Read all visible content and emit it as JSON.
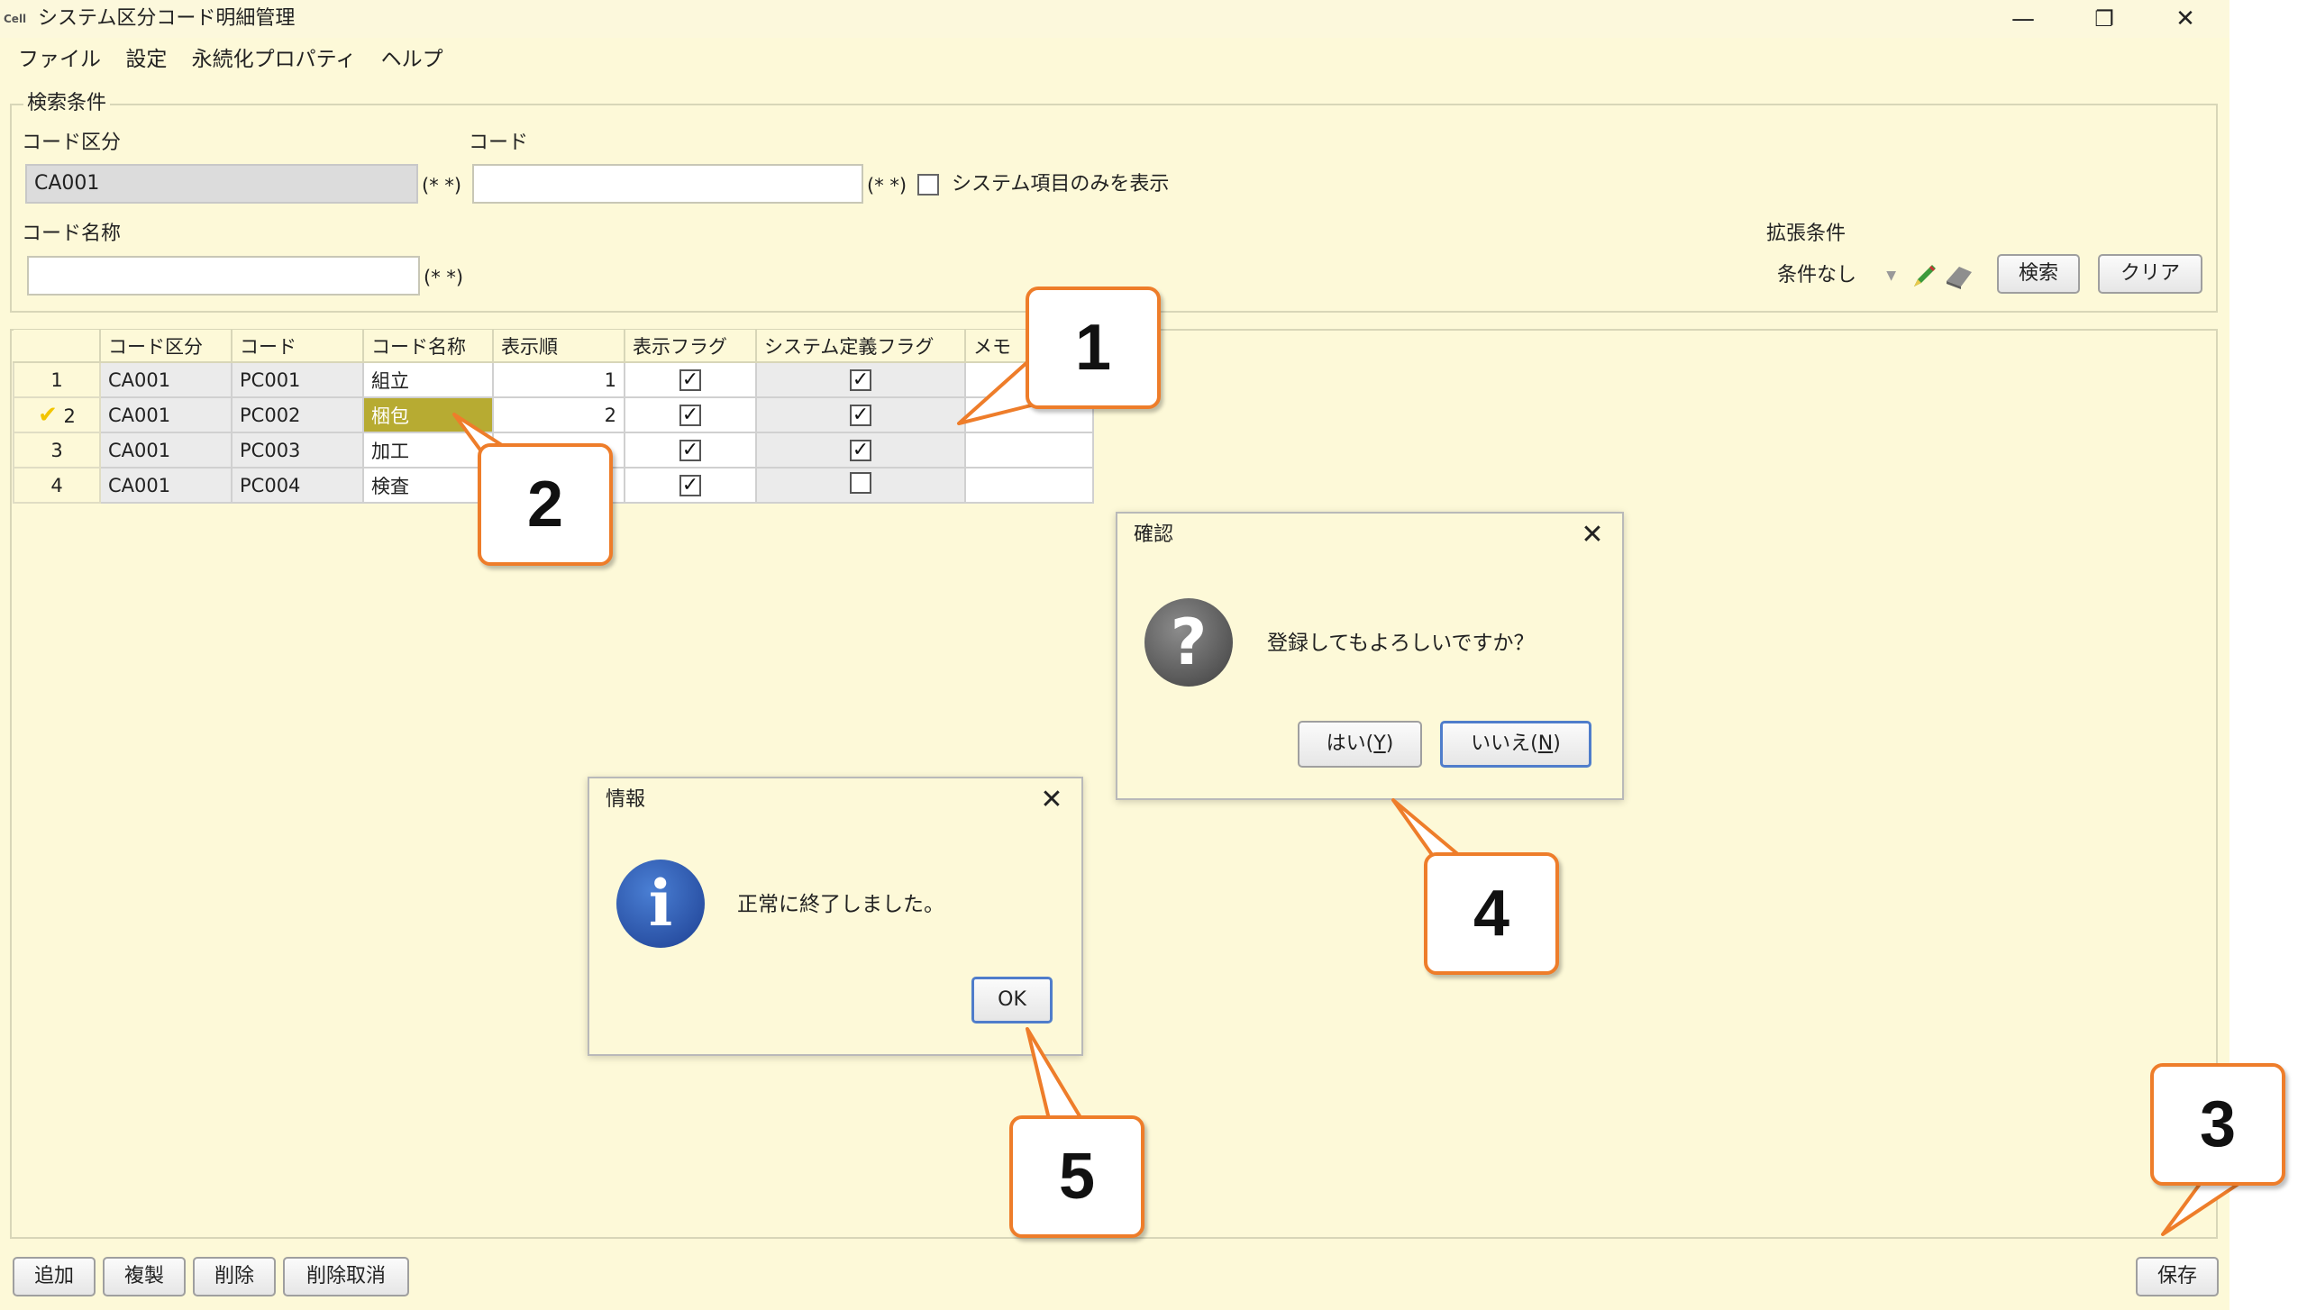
{
  "window": {
    "title": "システム区分コード明細管理",
    "icon_text": "Cell",
    "controls": {
      "minimize": "—",
      "maximize": "❐",
      "close": "✕"
    }
  },
  "menu": [
    "ファイル",
    "設定",
    "永続化プロパティ",
    "ヘルプ"
  ],
  "search": {
    "legend": "検索条件",
    "code_kubun_label": "コード区分",
    "code_kubun_value": "CA001",
    "code_label": "コード",
    "code_value": "",
    "code_name_label": "コード名称",
    "code_name_value": "",
    "wildcard_hint": "(* *)",
    "system_only_label": "システム項目のみを表示",
    "ext_label": "拡張条件",
    "ext_value": "条件なし",
    "search_button": "検索",
    "clear_button": "クリア"
  },
  "grid": {
    "headers": [
      "コード区分",
      "コード",
      "コード名称",
      "表示順",
      "表示フラグ",
      "システム定義フラグ",
      "メモ"
    ],
    "rows": [
      {
        "no": "1",
        "kubun": "CA001",
        "code": "PC001",
        "name": "組立",
        "order": "1",
        "display_flag": true,
        "system_flag": true,
        "memo": ""
      },
      {
        "no": "2",
        "kubun": "CA001",
        "code": "PC002",
        "name": "梱包",
        "order": "2",
        "display_flag": true,
        "system_flag": true,
        "memo": ""
      },
      {
        "no": "3",
        "kubun": "CA001",
        "code": "PC003",
        "name": "加工",
        "order": "",
        "display_flag": true,
        "system_flag": true,
        "memo": ""
      },
      {
        "no": "4",
        "kubun": "CA001",
        "code": "PC004",
        "name": "検査",
        "order": "",
        "display_flag": true,
        "system_flag": false,
        "memo": ""
      }
    ],
    "edited_marker": "✔"
  },
  "bottom_buttons": {
    "add": "追加",
    "copy": "複製",
    "delete": "削除",
    "undo_delete": "削除取消",
    "save": "保存"
  },
  "confirm_dialog": {
    "title": "確認",
    "icon": "question-icon",
    "message": "登録してもよろしいですか？",
    "yes_text": "はい(",
    "yes_key": "Y",
    "no_text": "いいえ(",
    "no_key": "N",
    "paren_close": ")"
  },
  "info_dialog": {
    "title": "情報",
    "icon": "info-icon",
    "message": "正常に終了しました。",
    "ok": "OK"
  },
  "callouts": [
    "1",
    "2",
    "3",
    "4",
    "5"
  ],
  "colors": {
    "window_bg": "#fdf9d8",
    "callout_border": "#ee7d2a",
    "selected_cell": "#b7ab32",
    "check_mark": "#f2c500"
  }
}
